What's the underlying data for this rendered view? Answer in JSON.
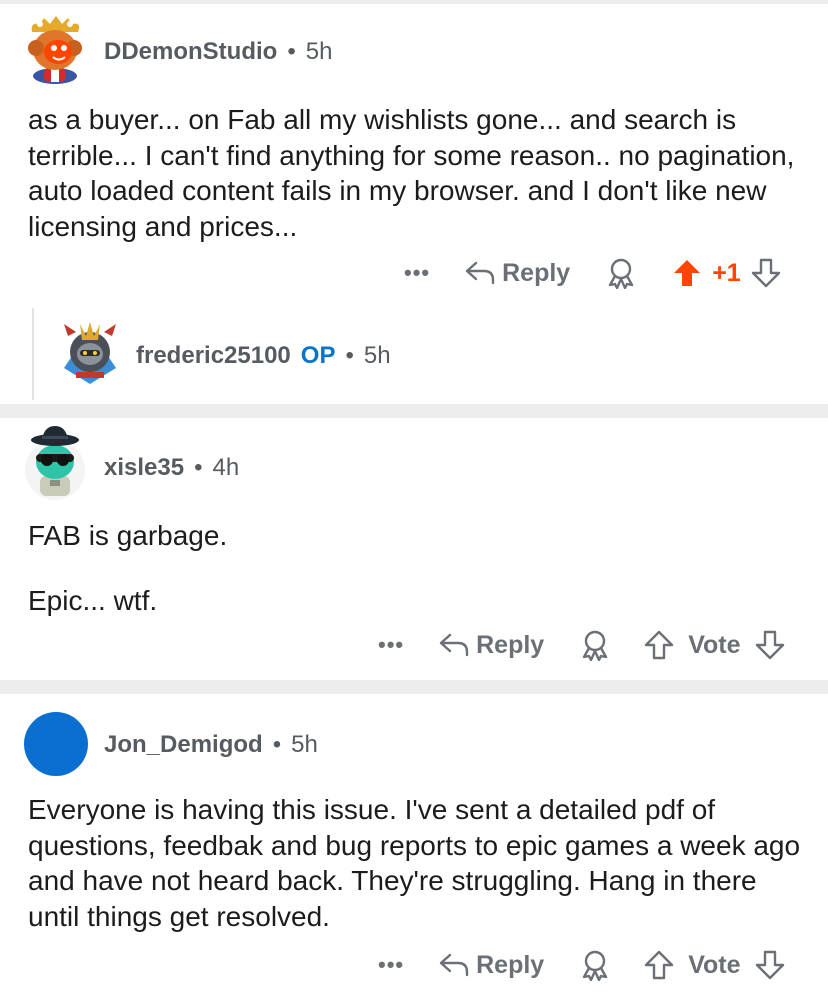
{
  "comments": [
    {
      "author": "DDemonStudio",
      "age": "5h",
      "body": [
        "as a buyer...  on Fab all my wishlists gone...  and search is terrible...  I can't find anything for some reason..  no pagination, auto loaded content fails in my browser. and I don't like new licensing and prices..."
      ],
      "actions": {
        "more": "•••",
        "reply": "Reply",
        "vote": "+1"
      },
      "colors": {
        "upvote": "#ff4500"
      },
      "reply_preview": {
        "author": "frederic25100",
        "badge": "OP",
        "age": "5h"
      }
    },
    {
      "author": "xisle35",
      "age": "4h",
      "body": [
        "FAB is garbage.",
        "Epic... wtf."
      ],
      "actions": {
        "more": "•••",
        "reply": "Reply",
        "vote": "Vote"
      }
    },
    {
      "author": "Jon_Demigod",
      "age": "5h",
      "body": [
        "Everyone is having this issue. I've sent a detailed pdf of questions, feedbak and bug reports to epic games a week ago and have not heard back. They're struggling. Hang in there until things get resolved."
      ],
      "actions": {
        "more": "•••",
        "reply": "Reply",
        "vote": "Vote"
      },
      "colors": {
        "avatar": "#0a6fd1"
      }
    }
  ],
  "icons": [
    "reply-icon",
    "award-icon",
    "upvote-icon",
    "downvote-icon",
    "more-icon"
  ]
}
